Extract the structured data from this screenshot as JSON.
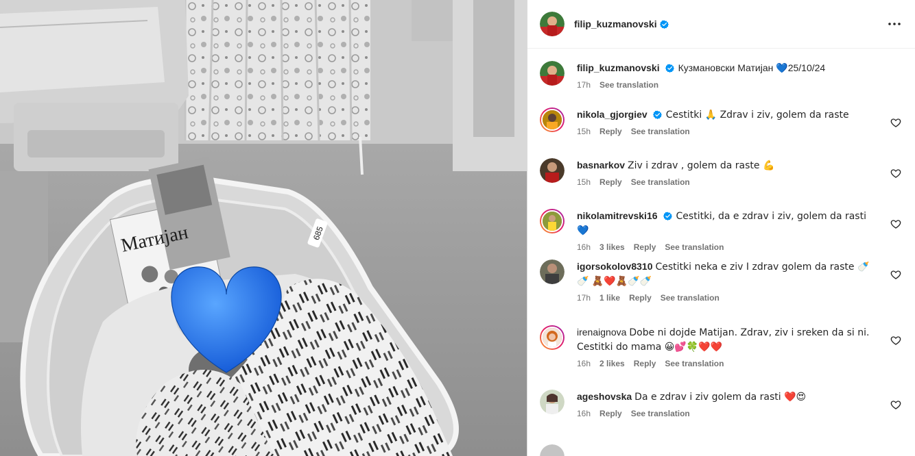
{
  "post": {
    "author": "filip_kuzmanovski",
    "caption": {
      "text_before": "Кузмановски Матијан",
      "emoji": "💙",
      "text_after": "25/10/24",
      "time": "17h",
      "see_translation": "See translation"
    }
  },
  "photo": {
    "card_title": "Матијан",
    "tag_number": "685"
  },
  "comments": [
    {
      "user": "nikola_gjorgiev",
      "verified": true,
      "text": "Cestitki 🙏 Zdrav i ziv, golem da raste",
      "time": "15h",
      "likes": "",
      "reply": "Reply",
      "translate": "See translation"
    },
    {
      "user": "basnarkov",
      "verified": false,
      "text": "Ziv i zdrav , golem da raste 💪",
      "time": "15h",
      "likes": "",
      "reply": "Reply",
      "translate": "See translation"
    },
    {
      "user": "nikolamitrevski16",
      "verified": true,
      "text": "Cestitki, da e zdrav i ziv, golem da rasti 💙",
      "time": "16h",
      "likes": "3 likes",
      "reply": "Reply",
      "translate": "See translation"
    },
    {
      "user": "igorsokolov8310",
      "verified": false,
      "text": "Cestitki neka e ziv I zdrav golem da raste 🍼🍼 🧸❤️🧸🍼🍼",
      "time": "17h",
      "likes": "1 like",
      "reply": "Reply",
      "translate": "See translation"
    },
    {
      "user": "irenaignova",
      "verified": false,
      "text": "Dobe ni dojde Matijan. Zdrav, ziv i sreken da si ni. Cestitki do mama 😀💕🍀❤️❤️",
      "time": "16h",
      "likes": "2 likes",
      "reply": "Reply",
      "translate": "See translation"
    },
    {
      "user": "ageshovska",
      "verified": false,
      "text": "Da e zdrav i ziv golem da rasti ❤️😍",
      "time": "16h",
      "likes": "",
      "reply": "Reply",
      "translate": "See translation"
    }
  ],
  "icons": {
    "more": "more-options-icon",
    "like": "heart-outline-icon",
    "verified": "verified-badge-icon"
  },
  "colors": {
    "verified": "#0095f6",
    "text": "#262626",
    "secondary": "#737373",
    "story_ring": "#e91e63"
  }
}
